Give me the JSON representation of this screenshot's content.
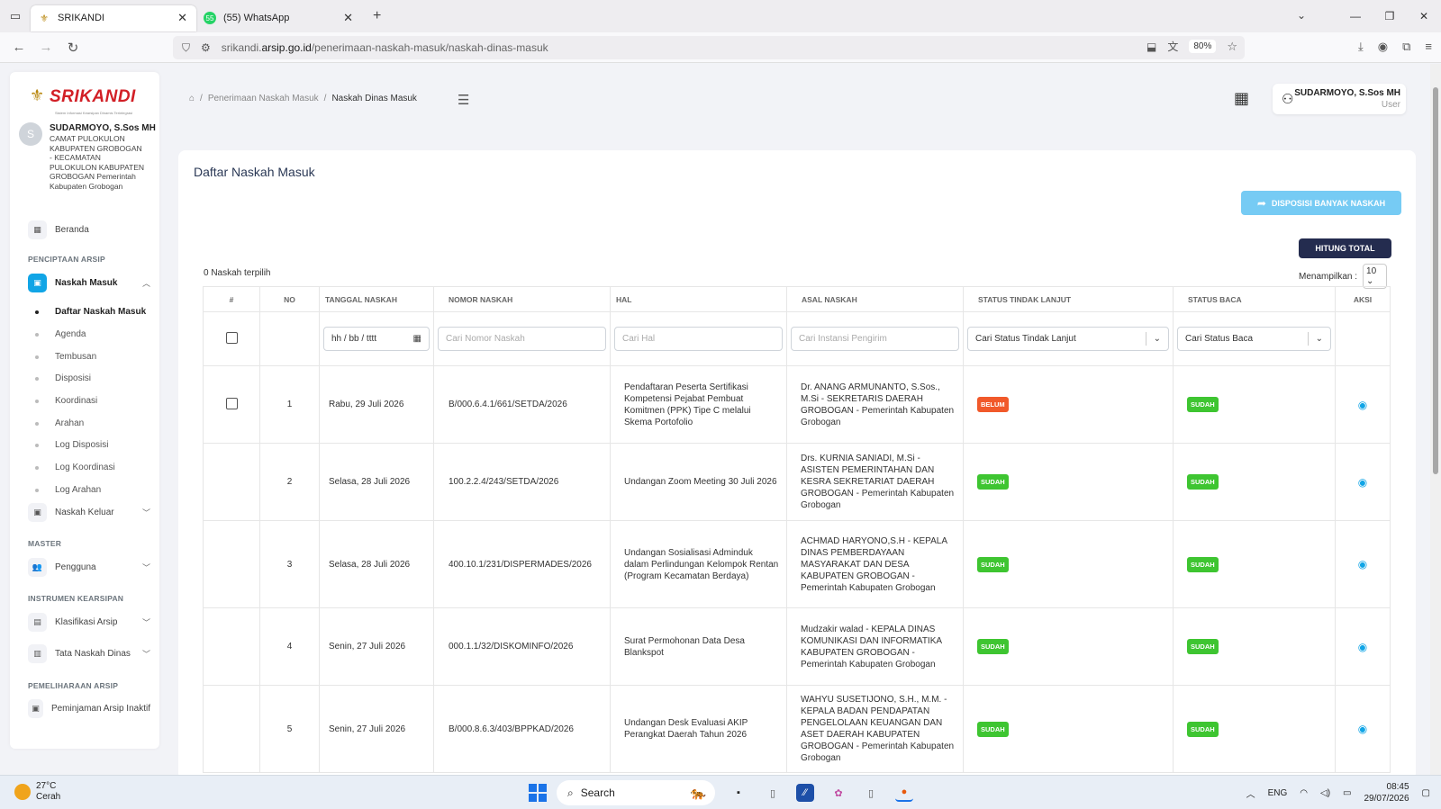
{
  "browser": {
    "tabs": [
      {
        "title": "SRIKANDI",
        "active": true
      },
      {
        "title": "(55) WhatsApp",
        "active": false
      }
    ],
    "url_prefix": "srikandi.",
    "url_domain": "arsip.go.id",
    "url_path": "/penerimaan-naskah-masuk/naskah-dinas-masuk",
    "zoom": "80%"
  },
  "sidebar": {
    "brand": "SRIKANDI",
    "brand_tagline": "Sistem Informasi Kearsipan Dinamis Terintegrasi",
    "avatar_initial": "S",
    "user_name": "SUDARMOYO, S.Sos MH",
    "user_desc": "CAMAT PULOKULON KABUPATEN GROBOGAN - KECAMATAN PULOKULON KABUPATEN GROBOGAN Pemerintah Kabupaten Grobogan",
    "beranda": "Beranda",
    "sec_penciptaan": "PENCIPTAAN ARSIP",
    "naskah_masuk": "Naskah Masuk",
    "sub_items": [
      "Daftar Naskah Masuk",
      "Agenda",
      "Tembusan",
      "Disposisi",
      "Koordinasi",
      "Arahan",
      "Log Disposisi",
      "Log Koordinasi",
      "Log Arahan"
    ],
    "naskah_keluar": "Naskah Keluar",
    "sec_master": "MASTER",
    "pengguna": "Pengguna",
    "sec_instrumen": "INSTRUMEN KEARSIPAN",
    "klasifikasi": "Klasifikasi Arsip",
    "tata_naskah": "Tata Naskah Dinas",
    "sec_pemeliharaan": "PEMELIHARAAN ARSIP",
    "peminjaman": "Peminjaman Arsip Inaktif"
  },
  "header": {
    "breadcrumb_1": "Penerimaan Naskah Masuk",
    "breadcrumb_2": "Naskah Dinas Masuk",
    "user_name": "SUDARMOYO, S.Sos MH",
    "user_role": "User"
  },
  "main": {
    "title": "Daftar Naskah Masuk",
    "btn_disposisi": "DISPOSISI BANYAK NASKAH",
    "btn_hitung": "HITUNG TOTAL",
    "selected_count": "0 Naskah terpilih",
    "perpage_label": "Menampilkan :",
    "perpage_value": "10",
    "columns": [
      "#",
      "NO",
      "TANGGAL NASKAH",
      "NOMOR NASKAH",
      "HAL",
      "ASAL NASKAH",
      "STATUS TINDAK LANJUT",
      "STATUS BACA",
      "AKSI"
    ],
    "filters": {
      "tanggal": "hh / bb / tttt",
      "nomor": "Cari Nomor Naskah",
      "hal": "Cari Hal",
      "asal": "Cari Instansi Pengirim",
      "status_tl": "Cari Status Tindak Lanjut",
      "status_baca": "Cari Status Baca"
    },
    "rows": [
      {
        "no": "1",
        "tanggal": "Rabu, 29 Juli 2026",
        "nomor": "B/000.6.4.1/661/SETDA/2026",
        "hal": "Pendaftaran Peserta Sertifikasi Kompetensi Pejabat Pembuat Komitmen (PPK) Tipe C melalui Skema Portofolio",
        "asal": "Dr. ANANG ARMUNANTO, S.Sos., M.Si - SEKRETARIS DAERAH GROBOGAN - Pemerintah Kabupaten Grobogan",
        "status_tl": "BELUM",
        "status_baca": "SUDAH"
      },
      {
        "no": "2",
        "tanggal": "Selasa, 28 Juli 2026",
        "nomor": "100.2.2.4/243/SETDA/2026",
        "hal": "Undangan Zoom Meeting 30 Juli 2026",
        "asal": "Drs. KURNIA SANIADI, M.Si - ASISTEN PEMERINTAHAN DAN KESRA SEKRETARIAT DAERAH GROBOGAN - Pemerintah Kabupaten Grobogan",
        "status_tl": "SUDAH",
        "status_baca": "SUDAH"
      },
      {
        "no": "3",
        "tanggal": "Selasa, 28 Juli 2026",
        "nomor": "400.10.1/231/DISPERMADES/2026",
        "hal": "Undangan Sosialisasi Adminduk dalam Perlindungan Kelompok Rentan (Program Kecamatan Berdaya)",
        "asal": "ACHMAD HARYONO,S.H - KEPALA DINAS PEMBERDAYAAN MASYARAKAT DAN DESA KABUPATEN GROBOGAN - Pemerintah Kabupaten Grobogan",
        "status_tl": "SUDAH",
        "status_baca": "SUDAH"
      },
      {
        "no": "4",
        "tanggal": "Senin, 27 Juli 2026",
        "nomor": "000.1.1/32/DISKOMINFO/2026",
        "hal": "Surat Permohonan Data Desa Blankspot",
        "asal": "Mudzakir walad - KEPALA DINAS KOMUNIKASI DAN INFORMATIKA KABUPATEN GROBOGAN - Pemerintah Kabupaten Grobogan",
        "status_tl": "SUDAH",
        "status_baca": "SUDAH"
      },
      {
        "no": "5",
        "tanggal": "Senin, 27 Juli 2026",
        "nomor": "B/000.8.6.3/403/BPPKAD/2026",
        "hal": "Undangan Desk Evaluasi AKIP Perangkat Daerah Tahun 2026",
        "asal": "WAHYU SUSETIJONO, S.H., M.M. - KEPALA BADAN PENDAPATAN PENGELOLAAN KEUANGAN DAN ASET DAERAH KABUPATEN GROBOGAN - Pemerintah Kabupaten Grobogan",
        "status_tl": "SUDAH",
        "status_baca": "SUDAH"
      }
    ]
  },
  "taskbar": {
    "temp": "27°C",
    "weather": "Cerah",
    "search": "Search",
    "lang": "ENG",
    "time": "08:45",
    "date": "29/07/2026"
  },
  "colors": {
    "accent": "#11a5e6",
    "badge_green": "#3ec531",
    "badge_orange": "#f1592a",
    "dark_button": "#242c4f",
    "brand_red": "#d21f26"
  }
}
